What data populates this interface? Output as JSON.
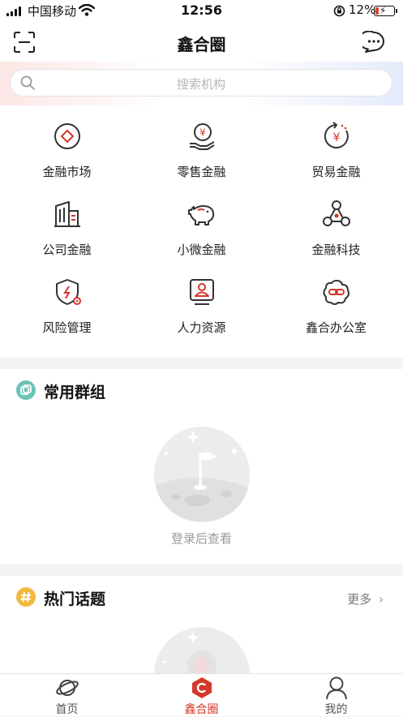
{
  "status_bar": {
    "carrier": "中国移动",
    "time": "12:56",
    "battery": "12%"
  },
  "header": {
    "title": "鑫合圈"
  },
  "search": {
    "placeholder": "搜索机构"
  },
  "grid": [
    {
      "label": "金融市场",
      "icon": "diamond-circle-icon"
    },
    {
      "label": "零售金融",
      "icon": "hand-yuan-coin-icon"
    },
    {
      "label": "贸易金融",
      "icon": "yuan-cycle-icon"
    },
    {
      "label": "公司金融",
      "icon": "office-building-icon"
    },
    {
      "label": "小微金融",
      "icon": "piggy-bank-icon"
    },
    {
      "label": "金融科技",
      "icon": "network-nodes-icon"
    },
    {
      "label": "风险管理",
      "icon": "shield-gear-icon"
    },
    {
      "label": "人力资源",
      "icon": "person-monitor-icon"
    },
    {
      "label": "鑫合办公室",
      "icon": "cloud-link-icon"
    }
  ],
  "groups": {
    "title": "常用群组",
    "empty_text": "登录后查看"
  },
  "topics": {
    "title": "热门话题",
    "more": "更多"
  },
  "tabs": [
    {
      "label": "首页",
      "icon": "planet-icon"
    },
    {
      "label": "鑫合圈",
      "icon": "xinhe-hexagon-icon",
      "active": true
    },
    {
      "label": "我的",
      "icon": "user-profile-icon"
    }
  ],
  "colors": {
    "accent": "#d3382a",
    "groups_icon": "#6dc3b7",
    "topics_icon": "#f2b940"
  }
}
